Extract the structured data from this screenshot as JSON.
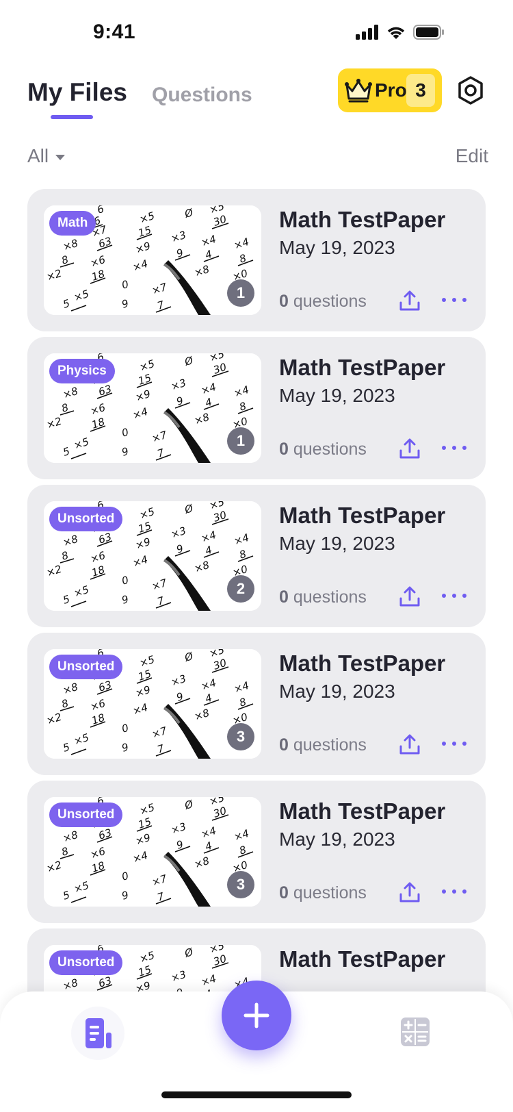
{
  "status_bar": {
    "time": "9:41"
  },
  "header": {
    "tabs": [
      {
        "label": "My Files",
        "active": true
      },
      {
        "label": "Questions",
        "active": false
      }
    ],
    "pro_badge": {
      "label": "Pro",
      "count": "3"
    },
    "settings_icon": "settings-icon"
  },
  "filter": {
    "label": "All",
    "edit_label": "Edit"
  },
  "files": [
    {
      "tag": "Math",
      "title": "Math TestPaper",
      "date": "May 19, 2023",
      "question_count": "0",
      "questions_label": "questions",
      "pages": "1"
    },
    {
      "tag": "Physics",
      "title": "Math TestPaper",
      "date": "May 19, 2023",
      "question_count": "0",
      "questions_label": "questions",
      "pages": "1"
    },
    {
      "tag": "Unsorted",
      "title": "Math TestPaper",
      "date": "May 19, 2023",
      "question_count": "0",
      "questions_label": "questions",
      "pages": "2"
    },
    {
      "tag": "Unsorted",
      "title": "Math TestPaper",
      "date": "May 19, 2023",
      "question_count": "0",
      "questions_label": "questions",
      "pages": "3"
    },
    {
      "tag": "Unsorted",
      "title": "Math TestPaper",
      "date": "May 19, 2023",
      "question_count": "0",
      "questions_label": "questions",
      "pages": "3"
    },
    {
      "tag": "Unsorted",
      "title": "Math TestPaper",
      "date": "",
      "question_count": "",
      "questions_label": "",
      "pages": ""
    }
  ],
  "bottom_nav": {
    "items": [
      {
        "icon": "document-icon",
        "active": true
      },
      {
        "icon": "calculator-icon",
        "active": false
      }
    ],
    "fab_icon": "plus-icon"
  },
  "colors": {
    "accent": "#6f5cf1",
    "pro": "#ffd927",
    "card_bg": "#ececef",
    "tag": "#7d63ee"
  }
}
